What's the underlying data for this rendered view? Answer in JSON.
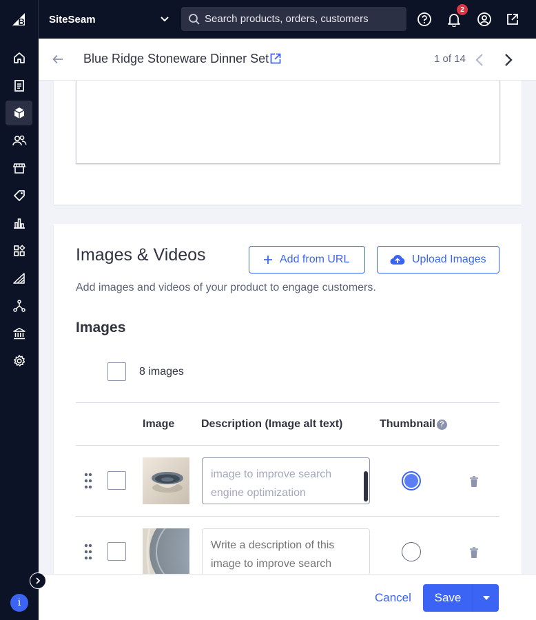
{
  "topbar": {
    "store_name": "SiteSeam",
    "search_placeholder": "Search products, orders, customers",
    "notification_count": "2"
  },
  "header": {
    "title": "Blue Ridge Stoneware Dinner Set",
    "pager": "1 of 14"
  },
  "images_section": {
    "title": "Images & Videos",
    "add_url_label": "Add from URL",
    "upload_label": "Upload Images",
    "description": "Add images and videos of your product to engage customers.",
    "subtitle": "Images",
    "count_label": "8 images",
    "columns": [
      "Image",
      "Description (Image alt text)",
      "Thumbnail"
    ],
    "rows": [
      {
        "alt_text": "image to improve search engine optimization",
        "thumbnail": true
      },
      {
        "alt_text": "Write a description of this image to improve search",
        "thumbnail": false
      }
    ]
  },
  "footer": {
    "cancel_label": "Cancel",
    "save_label": "Save"
  },
  "colors": {
    "accent": "#3c64f4",
    "nav_bg": "#0d1326",
    "badge": "#db3643"
  }
}
